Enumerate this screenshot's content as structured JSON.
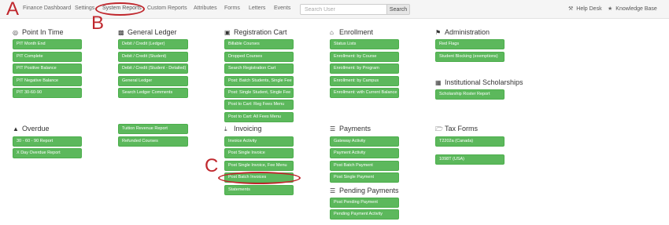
{
  "topnav": {
    "items": [
      "Finance Dashboard",
      "Settings",
      "System Reports",
      "Custom Reports",
      "Attributes",
      "Forms",
      "Letters",
      "Events"
    ],
    "search_placeholder": "Search User",
    "search_button": "Search",
    "help_desk": "Help Desk",
    "knowledge_base": "Knowledge Base"
  },
  "sections": {
    "pit": {
      "title": "Point In Time",
      "icon": "location-target-icon",
      "buttons": [
        "PIT Month End",
        "PIT Complete",
        "PIT Positive Balance",
        "PIT Negative Balance",
        "PIT 30-60-90"
      ]
    },
    "ledger": {
      "title": "General Ledger",
      "icon": "bar-chart-icon",
      "buttons": [
        "Debit / Credit (Ledger)",
        "Debit / Credit (Student)",
        "Debit / Credit (Student - Detailed)",
        "General Ledger",
        "Search Ledger Comments"
      ]
    },
    "ledger_extra": {
      "buttons": [
        "Tuition Revenue Report",
        "Refunded Courses"
      ]
    },
    "cart": {
      "title": "Registration Cart",
      "icon": "cart-icon",
      "buttons": [
        "Billable Courses",
        "Dropped Courses",
        "Search Registration Cart",
        "Post: Batch Students, Single Fee",
        "Post: Single Student, Single Fee",
        "Post to Cart: Reg Fees Menu",
        "Post to Cart: All Fees Menu"
      ]
    },
    "enrollment": {
      "title": "Enrollment",
      "icon": "home-icon",
      "buttons": [
        "Status Lists",
        "Enrollment: by Course",
        "Enrollment: by Program",
        "Enrollment: by Campus",
        "Enrollment: with Current Balance"
      ]
    },
    "admin": {
      "title": "Administration",
      "icon": "flag-icon",
      "buttons": [
        "Red Flags",
        "Student Blocking (exemptions)"
      ]
    },
    "scholarships": {
      "title": "Institutional Scholarships",
      "icon": "grid-icon",
      "buttons": [
        "Scholarship Roster Report"
      ]
    },
    "overdue": {
      "title": "Overdue",
      "icon": "warning-icon",
      "buttons": [
        "30 - 60 - 90 Report",
        "X Day Overdue Report"
      ]
    },
    "invoicing": {
      "title": "Invoicing",
      "icon": "download-icon",
      "buttons": [
        "Invoice Activity",
        "Post Single Invoice",
        "Post Single Invoice, Fee Menu",
        "Post Batch Invoices",
        "Statements"
      ]
    },
    "payments": {
      "title": "Payments",
      "icon": "list-icon",
      "buttons": [
        "Gateway Activity",
        "Payment Activity",
        "Post Batch Payment",
        "Post Single Payment"
      ]
    },
    "pending": {
      "title": "Pending Payments",
      "icon": "list-icon",
      "buttons": [
        "Post Pending Payment",
        "Pending Payment Activity"
      ]
    },
    "tax": {
      "title": "Tax Forms",
      "icon": "folder-open-icon",
      "buttons": [
        "T2202a (Canada)",
        "1098T (USA)"
      ]
    }
  },
  "annotations": {
    "a": "A",
    "b": "B",
    "c": "C"
  },
  "colors": {
    "button_green": "#5cb85c",
    "annotation_red": "#c0272d"
  }
}
